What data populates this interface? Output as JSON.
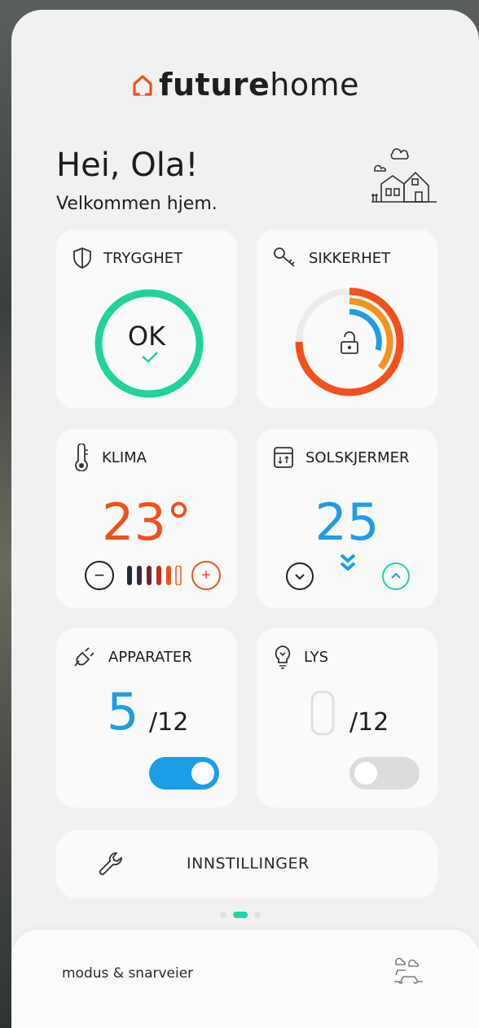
{
  "brand": {
    "prefix": "future",
    "suffix": "home",
    "accent": "#f3501c"
  },
  "header": {
    "greeting": "Hei, Ola!",
    "welcome": "Velkommen hjem."
  },
  "cards": {
    "trygghet": {
      "title": "TRYGGHET",
      "status": "OK",
      "ring_color": "#20d29c"
    },
    "sikkerhet": {
      "title": "SIKKERHET"
    },
    "klima": {
      "title": "KLIMA",
      "temperature": "23°",
      "minus": "−",
      "plus": "+"
    },
    "solskjermer": {
      "title": "SOLSKJERMER",
      "value": "25"
    },
    "apparater": {
      "title": "APPARATER",
      "count": "5",
      "total": "/12",
      "toggle_on": true
    },
    "lys": {
      "title": "LYS",
      "total": "/12",
      "toggle_on": false
    }
  },
  "settings": {
    "label": "INNSTILLINGER"
  },
  "pager": {
    "pages": 3,
    "active": 2
  },
  "bottom": {
    "label": "modus & snarveier"
  },
  "colors": {
    "orange": "#f3501c",
    "blue": "#1c9ee6",
    "teal": "#1ed6a6"
  }
}
